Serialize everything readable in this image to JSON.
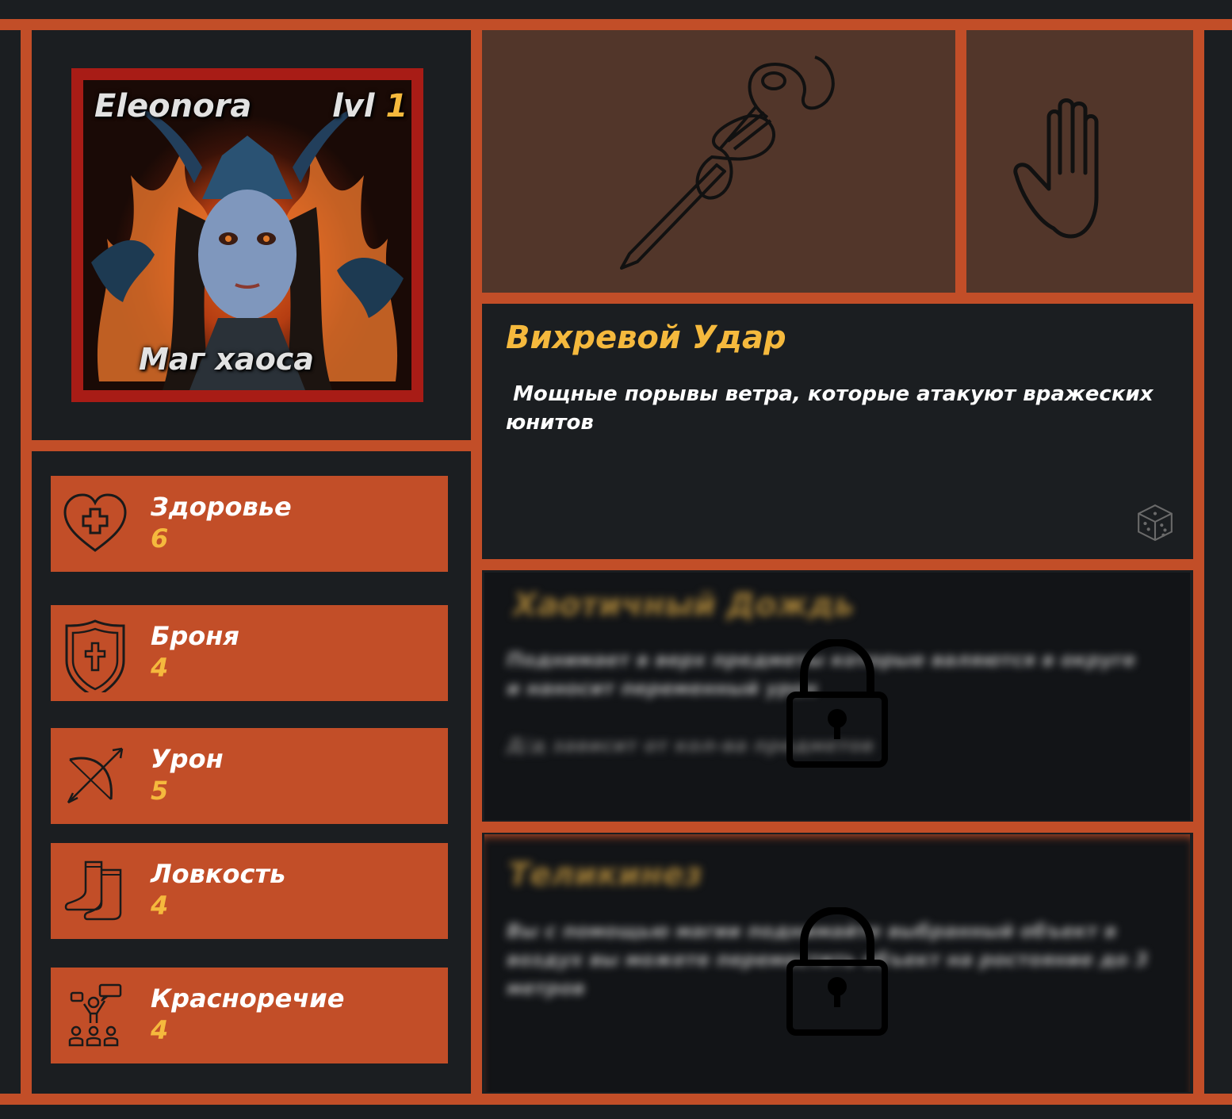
{
  "character": {
    "name": "Eleonora",
    "level_prefix": "lvl",
    "level": "1",
    "class_name": "Маг хаоса"
  },
  "stats": [
    {
      "label": "Здоровье",
      "value": "6",
      "icon": "heart-plus-icon"
    },
    {
      "label": "Броня",
      "value": "4",
      "icon": "shield-cross-icon"
    },
    {
      "label": "Урон",
      "value": "5",
      "icon": "bow-arrow-icon"
    },
    {
      "label": "Ловкость",
      "value": "4",
      "icon": "boots-icon"
    },
    {
      "label": "Красноречие",
      "value": "4",
      "icon": "speaker-crowd-icon"
    }
  ],
  "equipment": {
    "weapon_icon": "staff-icon",
    "hand_icon": "hand-icon"
  },
  "skills": [
    {
      "title": "Вихревой Удар",
      "description": " Мощные порывы ветра, которые атакуют вражеских юнитов",
      "locked": false,
      "icon": "dice-icon"
    },
    {
      "title": "Хаотичный Дождь",
      "description": "Поднимает в верх предметы которые валяются в округе и наносит переменный урон",
      "note": "Д/д зависит от кол-ва предметов",
      "locked": true,
      "icon": "lock-icon"
    },
    {
      "title": "Теликинез",
      "description": "Вы с помощью магии поднимайте выбранный объект в воздух вы можете переместить объект на ростояние до 3 метров",
      "locked": true,
      "icon": "lock-icon"
    }
  ],
  "colors": {
    "accent": "#c24e28",
    "background": "#1b1e21",
    "gold": "#f5b93d",
    "equipment_bg": "#52362a",
    "portrait_frame": "#a81c16"
  }
}
